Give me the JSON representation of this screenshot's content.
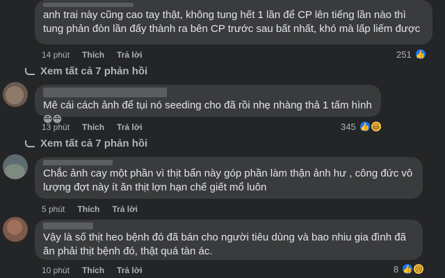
{
  "comments": [
    {
      "text": "anh trai này cũng cao tay thật, không tung hết 1 lần để CP lên tiếng lần nào thì tung phản đòn lần đấy thành ra bên CP trước sau bất nhất, khó mà lấp liếm được",
      "time": "14 phút",
      "like_label": "Thích",
      "reply_label": "Trả lời",
      "reaction_count": "251",
      "reactions": [
        "like-icon"
      ],
      "view_replies": "Xem tất cả 7 phản hồi"
    },
    {
      "text": "Mê cái cách ảnh để tụi nó seeding cho đã rồi nhẹ nhàng thả 1 tấm hình",
      "emoji_suffix": "😁😁",
      "time": "13 phút",
      "like_label": "Thích",
      "reply_label": "Trả lời",
      "reaction_count": "345",
      "reactions": [
        "like-icon",
        "haha-icon"
      ],
      "view_replies": "Xem tất cả 7 phản hồi"
    },
    {
      "text": "Chắc ảnh cay một phần vì thịt bẩn này góp phần làm thận ảnh hư , công đức vô lượng đợt này ít ăn thịt lợn hạn chế giết mổ luôn",
      "time": "5 phút",
      "like_label": "Thích",
      "reply_label": "Trả lời"
    },
    {
      "text": "Vậy là số thịt heo bệnh đó đã bán cho người tiêu dùng và bao nhiu gia đình đã ăn phải thịt bệnh đó, thật quá tàn ác.",
      "time": "10 phút",
      "like_label": "Thích",
      "reply_label": "Trả lời",
      "reaction_count": "8",
      "reactions": [
        "like-icon",
        "sad-icon"
      ]
    }
  ],
  "colors": {
    "background": "#242526",
    "bubble": "#3a3b3c",
    "text": "#e4e6eb",
    "secondary": "#b0b3b8",
    "like_blue": "#1877f2"
  }
}
